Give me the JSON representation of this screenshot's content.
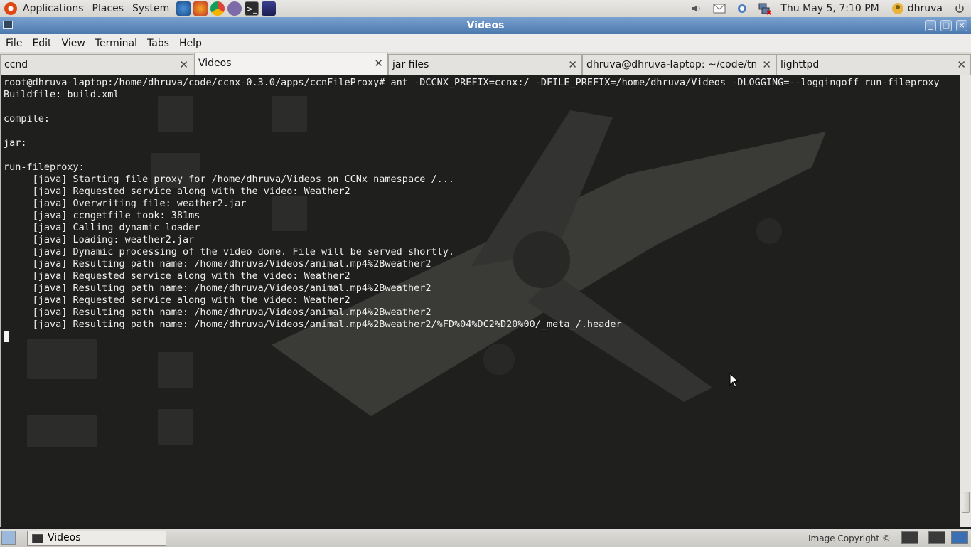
{
  "top_panel": {
    "menus": [
      "Applications",
      "Places",
      "System"
    ],
    "clock": "Thu May  5,  7:10 PM",
    "user": "dhruva"
  },
  "window": {
    "title": "Videos"
  },
  "menubar": [
    "File",
    "Edit",
    "View",
    "Terminal",
    "Tabs",
    "Help"
  ],
  "tabs": [
    {
      "label": "ccnd",
      "active": false
    },
    {
      "label": "Videos",
      "active": true
    },
    {
      "label": "jar files",
      "active": false
    },
    {
      "label": "dhruva@dhruva-laptop: ~/code/tmp",
      "active": false
    },
    {
      "label": "lighttpd",
      "active": false
    }
  ],
  "terminal": {
    "lines": [
      "root@dhruva-laptop:/home/dhruva/code/ccnx-0.3.0/apps/ccnFileProxy# ant -DCCNX_PREFIX=ccnx:/ -DFILE_PREFIX=/home/dhruva/Videos -DLOGGING=--loggingoff run-fileproxy",
      "Buildfile: build.xml",
      "",
      "compile:",
      "",
      "jar:",
      "",
      "run-fileproxy:",
      "     [java] Starting file proxy for /home/dhruva/Videos on CCNx namespace /...",
      "     [java] Requested service along with the video: Weather2",
      "     [java] Overwriting file: weather2.jar",
      "     [java] ccngetfile took: 381ms",
      "     [java] Calling dynamic loader",
      "     [java] Loading: weather2.jar",
      "     [java] Dynamic processing of the video done. File will be served shortly.",
      "     [java] Resulting path name: /home/dhruva/Videos/animal.mp4%2Bweather2",
      "     [java] Requested service along with the video: Weather2",
      "     [java] Resulting path name: /home/dhruva/Videos/animal.mp4%2Bweather2",
      "     [java] Requested service along with the video: Weather2",
      "     [java] Resulting path name: /home/dhruva/Videos/animal.mp4%2Bweather2",
      "     [java] Resulting path name: /home/dhruva/Videos/animal.mp4%2Bweather2/%FD%04%DC2%D20%00/_meta_/.header"
    ]
  },
  "bottom_panel": {
    "task_label": "Videos",
    "copyright": "Image Copyright ©"
  },
  "colors": {
    "titlebar": "#5a84b8",
    "terminal_bg": "#1f1f1e",
    "terminal_fg": "#efefef"
  }
}
